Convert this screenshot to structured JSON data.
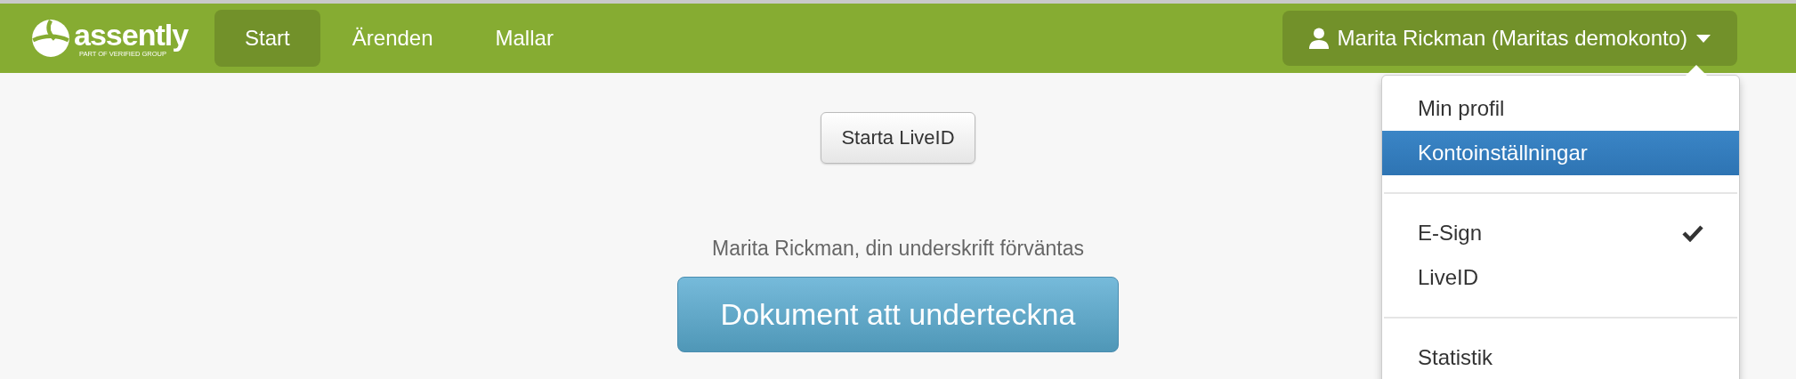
{
  "logo": {
    "name": "assently",
    "tagline": "PART OF VERIFIED GROUP"
  },
  "nav": [
    {
      "label": "Start",
      "selected": true
    },
    {
      "label": "Ärenden",
      "selected": false
    },
    {
      "label": "Mallar",
      "selected": false
    }
  ],
  "user_menu": {
    "label": "Marita Rickman (Maritas demokonto)",
    "expanded": true
  },
  "dropdown": {
    "groups": [
      [
        {
          "label": "Min profil",
          "selected": false
        },
        {
          "label": "Kontoinställningar",
          "selected": true
        }
      ],
      [
        {
          "label": "E-Sign",
          "checked": true
        },
        {
          "label": "LiveID",
          "checked": false
        }
      ],
      [
        {
          "label": "Statistik"
        }
      ]
    ]
  },
  "main": {
    "liveid_button": "Starta LiveID",
    "message": "Marita Rickman, din underskrift förväntas",
    "sign_button": "Dokument att underteckna"
  }
}
